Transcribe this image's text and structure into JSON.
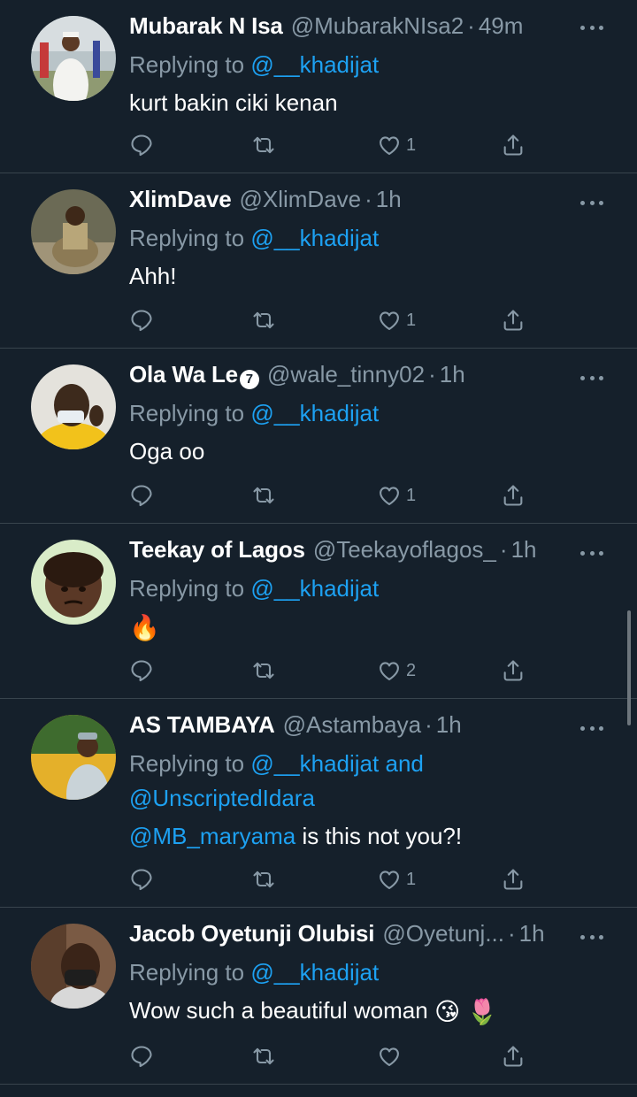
{
  "tweets": [
    {
      "name": "Mubarak N Isa",
      "handle": "@MubarakNIsa2",
      "time": "49m",
      "reply_prefix": "Replying to",
      "reply_to": "@__khadijat",
      "text": "kurt bakin ciki kenan",
      "likes": "1",
      "avatar_icon": "person-outdoors-white-robe"
    },
    {
      "name": "XlimDave",
      "handle": "@XlimDave",
      "time": "1h",
      "reply_prefix": "Replying to",
      "reply_to": "@__khadijat",
      "text": "Ahh!",
      "likes": "1",
      "avatar_icon": "child-sitting"
    },
    {
      "name": "Ola Wa Le",
      "verified_badge": "7",
      "handle": "@wale_tinny02",
      "time": "1h",
      "reply_prefix": "Replying to",
      "reply_to": "@__khadijat",
      "text": "Oga oo",
      "likes": "1",
      "avatar_icon": "person-yellow-shirt-mask"
    },
    {
      "name": "Teekay of Lagos",
      "handle": "@Teekayoflagos_",
      "time": "1h",
      "reply_prefix": "Replying to",
      "reply_to": "@__khadijat",
      "text_emoji": "🔥",
      "likes": "2",
      "avatar_icon": "child-face"
    },
    {
      "name": "AS TAMBAYA",
      "handle": "@Astambaya",
      "time": "1h",
      "reply_prefix": "Replying to",
      "reply_to": "@__khadijat",
      "reply_and": "and",
      "reply_to_2": "@UnscriptedIdara",
      "text_mention": "@MB_maryama",
      "text": "is this not you?!",
      "likes": "1",
      "avatar_icon": "person-cap-outdoors"
    },
    {
      "name": "Jacob Oyetunji Olubisi",
      "handle": "@Oyetunj...",
      "time": "1h",
      "reply_prefix": "Replying to",
      "reply_to": "@__khadijat",
      "text": "Wow such a beautiful woman",
      "text_emojis": "😘 🌷",
      "likes": "",
      "avatar_icon": "person-face-mask"
    }
  ],
  "colors": {
    "background": "#15202b",
    "divider": "#38444d",
    "secondary_text": "#8899a6",
    "link": "#1da1f2"
  }
}
